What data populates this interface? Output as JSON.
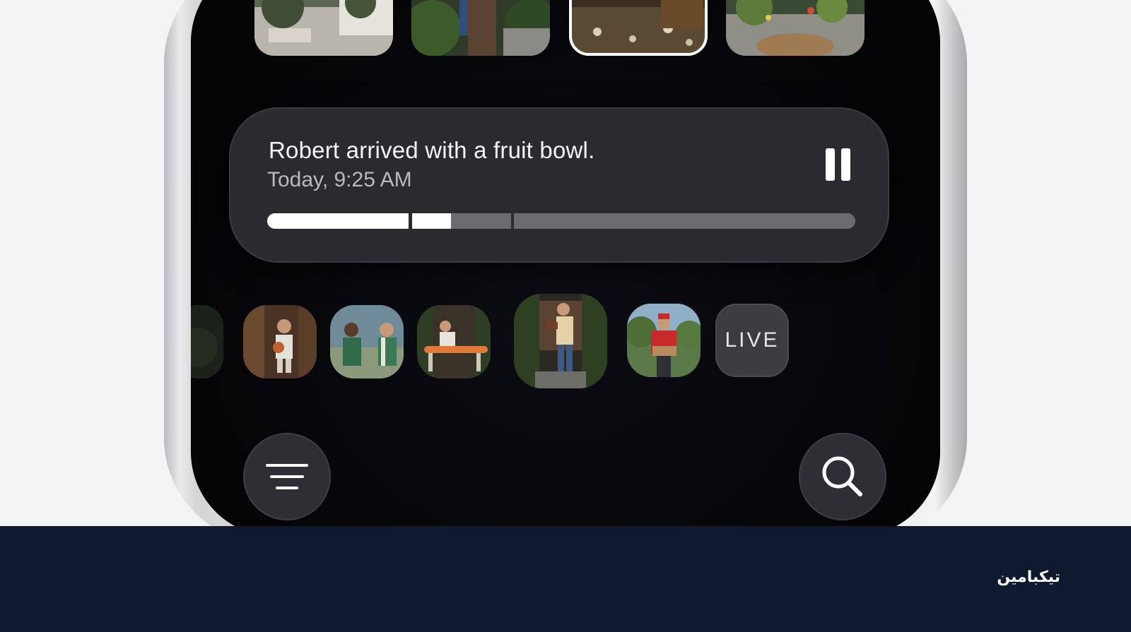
{
  "notification": {
    "title": "Robert arrived with a fruit bowl.",
    "time": "Today, 9:25 AM",
    "progress_played": 0.31
  },
  "clips": {
    "live_label": "LIVE"
  },
  "icons": {
    "pause": "pause-icon",
    "menu": "menu-lines-icon",
    "search": "search-icon"
  },
  "brand": {
    "name": "تیکبامین"
  },
  "colors": {
    "band": "#0f1a2e",
    "card": "#2a2b2f",
    "screen": "#050508"
  }
}
